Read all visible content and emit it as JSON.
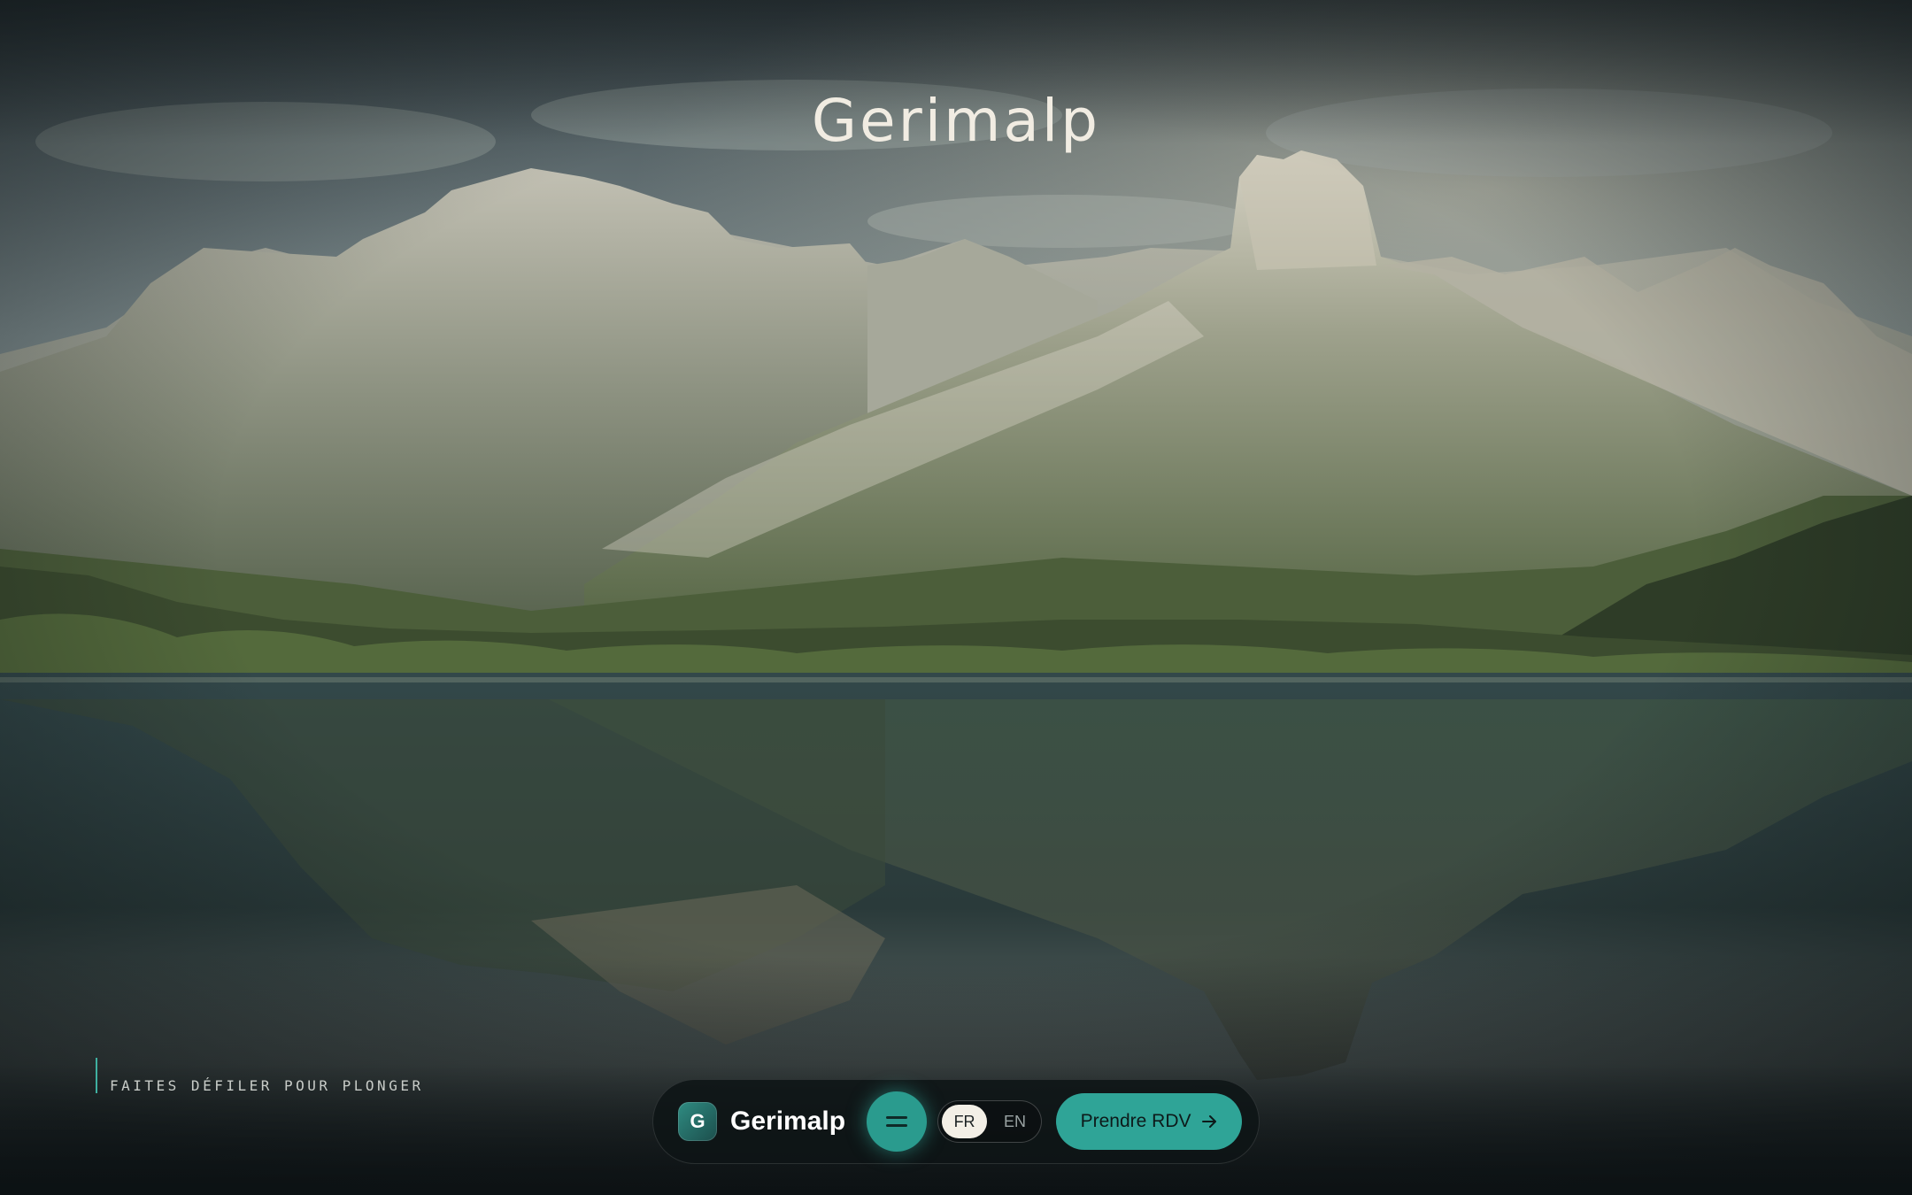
{
  "hero": {
    "title": "Gerimalp",
    "scroll_hint": "FAITES DÉFILER POUR PLONGER"
  },
  "dock": {
    "badge_letter": "G",
    "brand_name": "Gerimalp",
    "menu_icon": "equals-menu-icon",
    "languages": [
      {
        "code": "FR",
        "active": true
      },
      {
        "code": "EN",
        "active": false
      }
    ],
    "cta_label": "Prendre RDV",
    "cta_icon": "arrow-right-icon"
  },
  "colors": {
    "accent": "#2fa497",
    "text_light": "#f1ece2",
    "dock_bg": "#0e1416"
  }
}
